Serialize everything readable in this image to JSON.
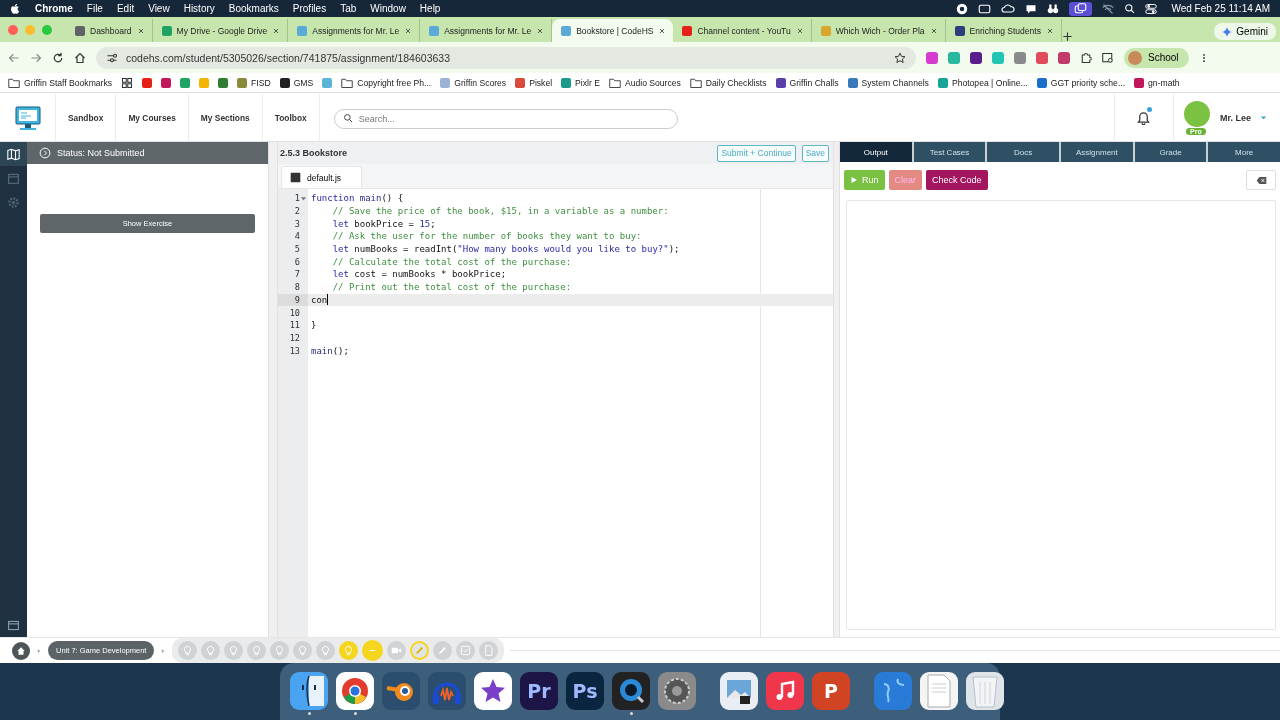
{
  "menu_bar": {
    "menus": [
      "Chrome",
      "File",
      "Edit",
      "View",
      "History",
      "Bookmarks",
      "Profiles",
      "Tab",
      "Window",
      "Help"
    ],
    "clock": "Wed Feb 25  11:14 AM"
  },
  "tabs": [
    {
      "title": "Dashboard",
      "selected": false,
      "color": "#5f6368"
    },
    {
      "title": "My Drive - Google Drive",
      "selected": false,
      "color": "#1fa463"
    },
    {
      "title": "Assignments for Mr. Le",
      "selected": false,
      "color": "#5aa9d6"
    },
    {
      "title": "Assignments for Mr. Le",
      "selected": false,
      "color": "#5aa9d6"
    },
    {
      "title": "Bookstore | CodeHS",
      "selected": true,
      "color": "#5aa9d6"
    },
    {
      "title": "Channel content - YouTu",
      "selected": false,
      "color": "#e62117"
    },
    {
      "title": "Which Wich - Order Pla",
      "selected": false,
      "color": "#d9a62e"
    },
    {
      "title": "Enriching Students",
      "selected": false,
      "color": "#2d3e7a"
    }
  ],
  "gemini": "Gemini",
  "url": "codehs.com/student/5305026/section/741875/assignment/184603633",
  "extensions": [
    {
      "color": "#d63bd0"
    },
    {
      "color": "#2bb8a0"
    },
    {
      "color": "#5a1e8c"
    },
    {
      "color": "#22c4b4"
    },
    {
      "color": "#8a8a8a"
    },
    {
      "color": "#e04a5a"
    },
    {
      "color": "#c23a6a"
    }
  ],
  "profile": "School",
  "bookmarks": [
    {
      "kind": "folder",
      "label": "Griffin Staff Bookmarks"
    },
    {
      "kind": "apps"
    },
    {
      "kind": "site",
      "color": "#e62117"
    },
    {
      "kind": "site",
      "color": "#c2185b"
    },
    {
      "kind": "site",
      "color": "#1fa463"
    },
    {
      "kind": "site",
      "color": "#f4b400"
    },
    {
      "kind": "site",
      "color": "#2e7d32"
    },
    {
      "kind": "site",
      "label": "FISD",
      "color": "#8a8a3a"
    },
    {
      "kind": "site",
      "label": "GMS",
      "color": "#222222"
    },
    {
      "kind": "site",
      "color": "#5ab4d6"
    },
    {
      "kind": "folder",
      "label": "Copyright free Ph..."
    },
    {
      "kind": "site",
      "label": "Griffin Scores",
      "color": "#9bb4d6"
    },
    {
      "kind": "site",
      "label": "Piskel",
      "color": "#d94a3a"
    },
    {
      "kind": "site",
      "label": "Pixlr E",
      "color": "#1a9a8a"
    },
    {
      "kind": "folder",
      "label": "Audio Sources"
    },
    {
      "kind": "folder",
      "label": "Daily Checklists"
    },
    {
      "kind": "site",
      "label": "Griffin Challs",
      "color": "#5b3fa8"
    },
    {
      "kind": "site",
      "label": "System Channels",
      "color": "#3a7ab8"
    },
    {
      "kind": "site",
      "label": "Photopea | Online...",
      "color": "#18a497"
    },
    {
      "kind": "site",
      "label": "GGT priority sche...",
      "color": "#1a6fc9"
    },
    {
      "kind": "site",
      "label": "gn-math",
      "color": "#c2185b"
    }
  ],
  "codehs": {
    "nav": [
      "Sandbox",
      "My Courses",
      "My Sections",
      "Toolbox"
    ],
    "search_placeholder": "Search...",
    "notification": true,
    "user": "Mr. Lee",
    "badge": "Pro"
  },
  "sidebar": {
    "status": "Status: Not Submitted",
    "button": "Show Exercise"
  },
  "editor": {
    "title": "2.5.3 Bookstore",
    "buttons": [
      "Submit + Continue",
      "Save"
    ],
    "file": "default.js",
    "lines": [
      {
        "number": "1",
        "foldable": true,
        "active": false,
        "tokens": [
          {
            "kind": "keyword",
            "text": "function"
          },
          {
            "kind": "func",
            "text": " main"
          },
          {
            "kind": "plain",
            "text": "() {"
          }
        ]
      },
      {
        "number": "2",
        "foldable": false,
        "active": false,
        "tokens": [
          {
            "kind": "comment",
            "text": "    // Save the price of the book, $15, in a variable as a number:"
          }
        ]
      },
      {
        "number": "3",
        "foldable": false,
        "active": false,
        "tokens": [
          {
            "kind": "keyword",
            "text": "    let"
          },
          {
            "kind": "plain",
            "text": " bookPrice = "
          },
          {
            "kind": "number",
            "text": "15"
          },
          {
            "kind": "plain",
            "text": ";"
          }
        ]
      },
      {
        "number": "4",
        "foldable": false,
        "active": false,
        "tokens": [
          {
            "kind": "comment",
            "text": "    // Ask the user for the number of books they want to buy:"
          }
        ]
      },
      {
        "number": "5",
        "foldable": false,
        "active": false,
        "tokens": [
          {
            "kind": "keyword",
            "text": "    let"
          },
          {
            "kind": "plain",
            "text": " numBooks = readInt("
          },
          {
            "kind": "string",
            "text": "\"How many books would you like to buy?\""
          },
          {
            "kind": "plain",
            "text": ");"
          }
        ]
      },
      {
        "number": "6",
        "foldable": false,
        "active": false,
        "tokens": [
          {
            "kind": "comment",
            "text": "    // Calculate the total cost of the purchase:"
          }
        ]
      },
      {
        "number": "7",
        "foldable": false,
        "active": false,
        "tokens": [
          {
            "kind": "keyword",
            "text": "    let"
          },
          {
            "kind": "plain",
            "text": " cost = numBooks * bookPrice;"
          }
        ]
      },
      {
        "number": "8",
        "foldable": false,
        "active": false,
        "tokens": [
          {
            "kind": "comment",
            "text": "    // Print out the total cost of the purchase:"
          }
        ]
      },
      {
        "number": "9",
        "foldable": false,
        "active": true,
        "tokens": [
          {
            "kind": "plain",
            "text": "con"
          }
        ]
      },
      {
        "number": "10",
        "foldable": false,
        "active": false
      },
      {
        "number": "11",
        "foldable": false,
        "active": false,
        "tokens": [
          {
            "kind": "plain",
            "text": "}"
          }
        ]
      },
      {
        "number": "12",
        "foldable": false,
        "active": false
      },
      {
        "number": "13",
        "foldable": false,
        "active": false,
        "tokens": [
          {
            "kind": "func",
            "text": "main"
          },
          {
            "kind": "plain",
            "text": "();"
          }
        ]
      }
    ]
  },
  "output": {
    "tabs": [
      {
        "label": "Output",
        "selected": true
      },
      {
        "label": "Test Cases",
        "selected": false
      },
      {
        "label": "Docs",
        "selected": false
      },
      {
        "label": "Assignment",
        "selected": false
      },
      {
        "label": "Grade",
        "selected": false
      },
      {
        "label": "More",
        "selected": false
      }
    ],
    "buttons": [
      {
        "kind": "run",
        "label": "Run"
      },
      {
        "kind": "clear",
        "label": "Clear"
      },
      {
        "kind": "check",
        "label": "Check Code"
      }
    ]
  },
  "course_bar": {
    "unit": "Unit 7: Game Development",
    "steps": [
      {
        "kind": "lightbulb",
        "done": false,
        "in_progress": false,
        "selected": false
      },
      {
        "kind": "lightbulb",
        "done": false,
        "in_progress": false,
        "selected": false
      },
      {
        "kind": "lightbulb",
        "done": false,
        "in_progress": false,
        "selected": false
      },
      {
        "kind": "lightbulb",
        "done": false,
        "in_progress": false,
        "selected": false
      },
      {
        "kind": "lightbulb",
        "done": false,
        "in_progress": false,
        "selected": false
      },
      {
        "kind": "lightbulb",
        "done": false,
        "in_progress": false,
        "selected": false
      },
      {
        "kind": "lightbulb",
        "done": false,
        "in_progress": false,
        "selected": false
      },
      {
        "kind": "lightbulb",
        "done": true,
        "in_progress": false,
        "selected": false
      },
      {
        "kind": "code",
        "done": true,
        "in_progress": false,
        "selected": true
      },
      {
        "kind": "video",
        "done": false,
        "in_progress": false,
        "selected": false
      },
      {
        "kind": "pencil",
        "done": false,
        "in_progress": true,
        "selected": false
      },
      {
        "kind": "pencil",
        "done": false,
        "in_progress": false,
        "selected": false
      },
      {
        "kind": "check",
        "done": false,
        "in_progress": false,
        "selected": false
      },
      {
        "kind": "document",
        "done": false,
        "in_progress": false,
        "selected": false
      }
    ]
  },
  "dock": [
    {
      "kind": "finder",
      "color": "#4aa3f0",
      "running": true
    },
    {
      "kind": "browser",
      "color": "#ffffff",
      "running": true
    },
    {
      "kind": "eye",
      "color": "#2b4e6e",
      "running": false
    },
    {
      "kind": "headphones",
      "color": "#2b4e6e",
      "running": false
    },
    {
      "kind": "star",
      "color": "#ffffff",
      "running": false
    },
    {
      "kind": "letters",
      "label": "Pr",
      "color": "#1d1546",
      "running": false
    },
    {
      "kind": "letters",
      "label": "Ps",
      "color": "#0a2540",
      "running": false
    },
    {
      "kind": "lens",
      "color": "#222222",
      "running": true
    },
    {
      "kind": "gear",
      "color": "#8a8a8a",
      "running": false
    },
    {
      "kind": "separator"
    },
    {
      "kind": "photo",
      "color": "#e8eef4",
      "running": false
    },
    {
      "kind": "note",
      "color": "#f0364a",
      "running": false
    },
    {
      "kind": "letters",
      "label": "P",
      "color": "#d04423",
      "running": false
    },
    {
      "kind": "separator"
    },
    {
      "kind": "globe",
      "color": "#2a7ad8",
      "running": false
    },
    {
      "kind": "document",
      "color": "#f4f4f4",
      "running": false
    },
    {
      "kind": "trash",
      "color": "#dfe4e8",
      "running": false
    }
  ]
}
